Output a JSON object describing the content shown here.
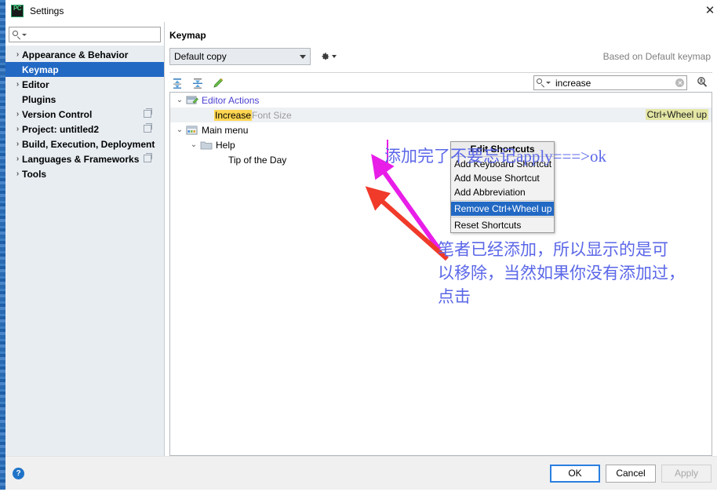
{
  "window": {
    "title": "Settings",
    "app_icon": "pycharm-icon",
    "close_label": "✕"
  },
  "sidebar": {
    "search": {
      "value": "",
      "placeholder": ""
    },
    "items": [
      {
        "label": "Appearance & Behavior",
        "arrow": "›",
        "selected": false,
        "indent": 0,
        "badge": false
      },
      {
        "label": "Keymap",
        "arrow": "",
        "selected": true,
        "indent": 1,
        "badge": false
      },
      {
        "label": "Editor",
        "arrow": "›",
        "selected": false,
        "indent": 0,
        "badge": false
      },
      {
        "label": "Plugins",
        "arrow": "",
        "selected": false,
        "indent": 1,
        "badge": false
      },
      {
        "label": "Version Control",
        "arrow": "›",
        "selected": false,
        "indent": 0,
        "badge": true
      },
      {
        "label": "Project: untitled2",
        "arrow": "›",
        "selected": false,
        "indent": 0,
        "badge": true
      },
      {
        "label": "Build, Execution, Deployment",
        "arrow": "›",
        "selected": false,
        "indent": 0,
        "badge": false
      },
      {
        "label": "Languages & Frameworks",
        "arrow": "›",
        "selected": false,
        "indent": 0,
        "badge": true
      },
      {
        "label": "Tools",
        "arrow": "›",
        "selected": false,
        "indent": 0,
        "badge": false
      }
    ]
  },
  "main": {
    "title": "Keymap",
    "keymap_select": {
      "value": "Default copy"
    },
    "gear_label": "gear-icon",
    "based_on": "Based on Default keymap",
    "toolbar": {
      "expand_all": "expand-all-icon",
      "collapse_all": "collapse-all-icon",
      "edit": "edit-pencil-icon"
    },
    "find": {
      "value": "increase",
      "placeholder": ""
    },
    "tree": [
      {
        "label": "Editor Actions",
        "twisty": "⌄",
        "icon": "editor-actions-icon",
        "style": "link",
        "indent": 0,
        "highlight": false,
        "shortcut": ""
      },
      {
        "label_hit": "Increase",
        "label_rest": " Font Size",
        "twisty": "",
        "icon": "",
        "style": "action",
        "indent": 2,
        "highlight": true,
        "shortcut": "Ctrl+Wheel up"
      },
      {
        "label": "Main menu",
        "twisty": "⌄",
        "icon": "main-menu-icon",
        "style": "plain",
        "indent": 0,
        "highlight": false,
        "shortcut": ""
      },
      {
        "label": "Help",
        "twisty": "⌄",
        "icon": "folder-icon",
        "style": "plain",
        "indent": 1,
        "highlight": false,
        "shortcut": ""
      },
      {
        "label": "Tip of the Day",
        "twisty": "",
        "icon": "",
        "style": "plain",
        "indent": 3,
        "highlight": false,
        "shortcut": ""
      }
    ]
  },
  "context_menu": {
    "header": "Edit Shortcuts",
    "items": [
      {
        "label": "Add Keyboard Shortcut",
        "selected": false,
        "divider_before": false
      },
      {
        "label": "Add Mouse Shortcut",
        "selected": false,
        "divider_before": false
      },
      {
        "label": "Add Abbreviation",
        "selected": false,
        "divider_before": false
      },
      {
        "label": "Remove Ctrl+Wheel up",
        "selected": true,
        "divider_before": true
      },
      {
        "label": "Reset Shortcuts",
        "selected": false,
        "divider_before": true
      }
    ]
  },
  "annotations": {
    "note_top": "添加完了不要忘记apply===>ok",
    "note_body_line1": "笔者已经添加，所以显示的是可",
    "note_body_line2": "以移除，当然如果你没有添加过，",
    "note_body_line3": "点击",
    "color_magenta": "#e81ee8",
    "color_red": "#f03a2a",
    "color_text": "#5b67e8"
  },
  "footer": {
    "help": "?",
    "ok": "OK",
    "cancel": "Cancel",
    "apply": "Apply"
  }
}
